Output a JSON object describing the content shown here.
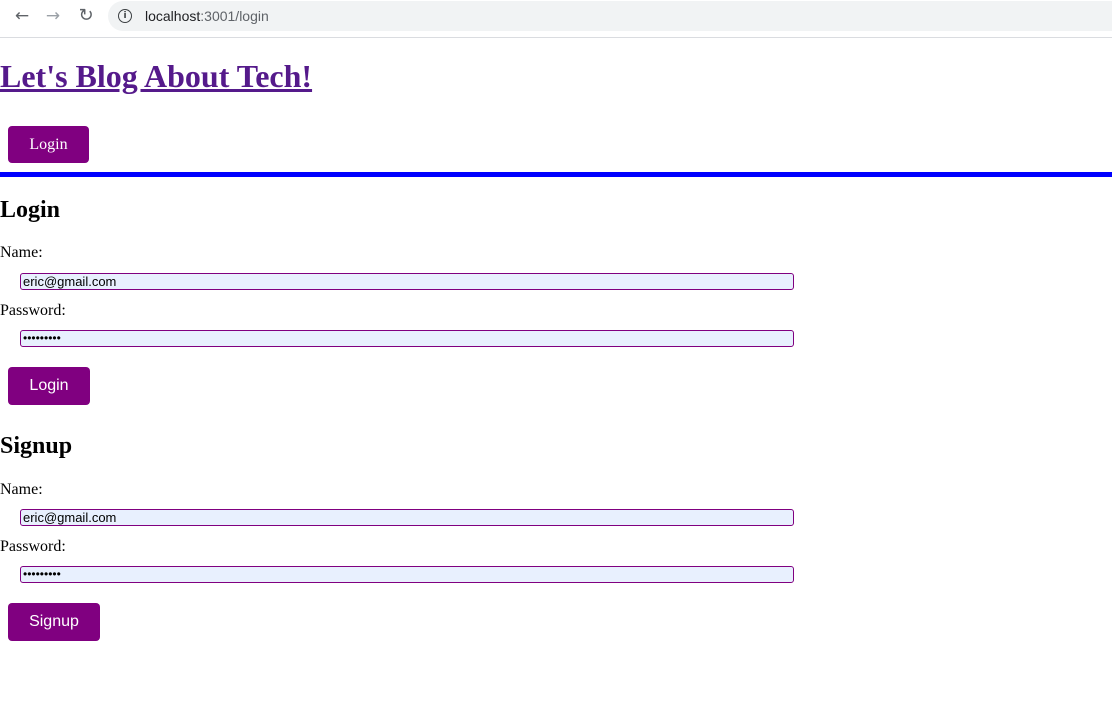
{
  "browser": {
    "url_host": "localhost",
    "url_path": ":3001/login"
  },
  "site": {
    "title": "Let's Blog About Tech!",
    "nav_login_label": "Login"
  },
  "login_form": {
    "heading": "Login",
    "name_label": "Name:",
    "name_value": "eric@gmail.com",
    "password_label": "Password:",
    "password_value": "•••••••••",
    "submit_label": "Login"
  },
  "signup_form": {
    "heading": "Signup",
    "name_label": "Name:",
    "name_value": "eric@gmail.com",
    "password_label": "Password:",
    "password_value": "•••••••••",
    "submit_label": "Signup"
  },
  "colors": {
    "button_bg": "#800080",
    "divider": "#0000ff",
    "link": "#551a8b",
    "input_bg": "#e8f0fe"
  }
}
